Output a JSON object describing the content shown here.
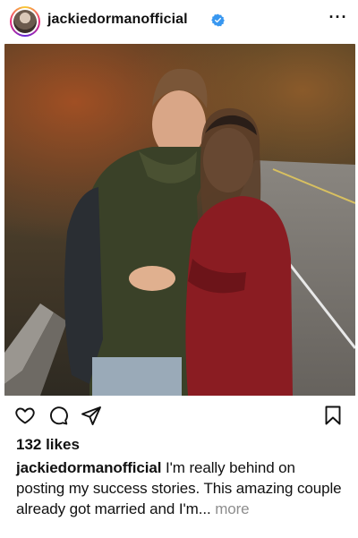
{
  "post": {
    "username": "jackiedormanofficial",
    "verified": true,
    "likes_text": "132 likes",
    "caption_user": "jackiedormanofficial",
    "caption_text": " I'm really behind on posting my success stories. This amazing couple already got married and I'm... ",
    "more_label": "more",
    "menu_label": "···"
  },
  "icons": {
    "avatar": "profile-avatar",
    "verified": "verified-badge-icon",
    "menu": "more-options-icon",
    "like": "heart-icon",
    "comment": "comment-icon",
    "share": "share-icon",
    "save": "bookmark-icon"
  },
  "colors": {
    "verified_blue": "#3897f0",
    "muted": "#8e8e8e"
  }
}
